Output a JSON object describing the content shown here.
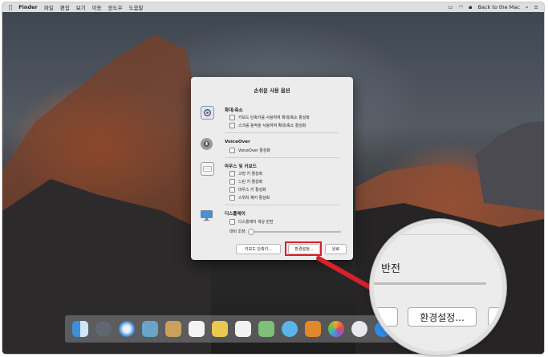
{
  "menubar": {
    "apple": "",
    "app_name": "Finder",
    "menus": [
      "파일",
      "편집",
      "보기",
      "이동",
      "윈도우",
      "도움말"
    ],
    "right_label": "Back to the Mac"
  },
  "dialog": {
    "title": "손쉬운 사용 옵션",
    "sections": [
      {
        "title": "확대/축소",
        "icon": "zoom-icon",
        "options": [
          "키보드 단축키를 사용하여 확대/축소 활성화",
          "스크롤 동작을 사용하여 확대/축소 활성화"
        ]
      },
      {
        "title": "VoiceOver",
        "icon": "voiceover-icon",
        "options": [
          "VoiceOver 활성화"
        ]
      },
      {
        "title": "마우스 및 키보드",
        "icon": "keyboard-icon",
        "options": [
          "고정 키 활성화",
          "느린 키 활성화",
          "마우스 키 활성화",
          "스위치 제어 활성화"
        ]
      },
      {
        "title": "디스플레이",
        "icon": "display-icon",
        "options": [
          "디스플레이 색상 반전"
        ]
      }
    ],
    "contrast_label": "대비 조정:",
    "contrast_level": 0,
    "buttons": {
      "shortcuts": "키보드 단축키...",
      "preferences": "환경설정...",
      "done": "완료"
    }
  },
  "zoom": {
    "text": "반전",
    "button": "환경설정..."
  },
  "colors": {
    "highlight": "#d6202a",
    "arrow": "#d6202a"
  }
}
